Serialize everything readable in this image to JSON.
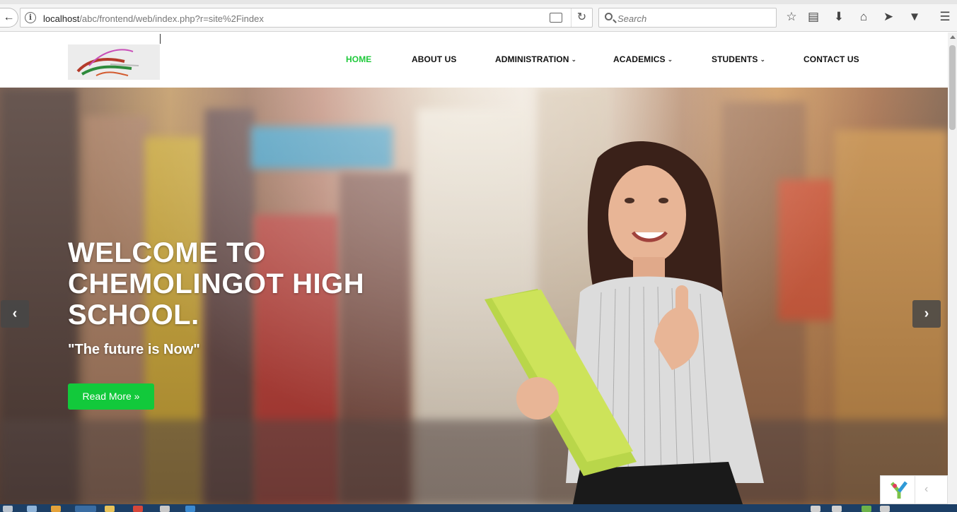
{
  "browser": {
    "url_host": "localhost",
    "url_path": "/abc/frontend/web/index.php?r=site%2Findex",
    "search_placeholder": "Search"
  },
  "nav": {
    "items": [
      {
        "label": "HOME",
        "active": true,
        "dropdown": false
      },
      {
        "label": "ABOUT US",
        "active": false,
        "dropdown": false
      },
      {
        "label": "ADMINISTRATION",
        "active": false,
        "dropdown": true
      },
      {
        "label": "ACADEMICS",
        "active": false,
        "dropdown": true
      },
      {
        "label": "STUDENTS",
        "active": false,
        "dropdown": true
      },
      {
        "label": "CONTACT US",
        "active": false,
        "dropdown": false
      }
    ]
  },
  "hero": {
    "title": "WELCOME TO CHEMOLINGOT HIGH SCHOOL.",
    "subtitle": "\"The future is Now\"",
    "button_label": "Read More »"
  },
  "colors": {
    "accent": "#12c93b",
    "nav_active": "#1ec93a",
    "taskbar": "#1c3f66"
  },
  "icons": {
    "back": "back-arrow-icon",
    "info": "info-icon",
    "reader": "reader-view-icon",
    "reload": "reload-icon",
    "search": "search-icon",
    "bookmark": "star-icon",
    "library": "clipboard-icon",
    "download": "download-icon",
    "home": "home-icon",
    "send": "paper-plane-icon",
    "pocket": "pocket-icon",
    "menu": "hamburger-menu-icon",
    "prev": "chevron-left-icon",
    "next": "chevron-right-icon"
  }
}
